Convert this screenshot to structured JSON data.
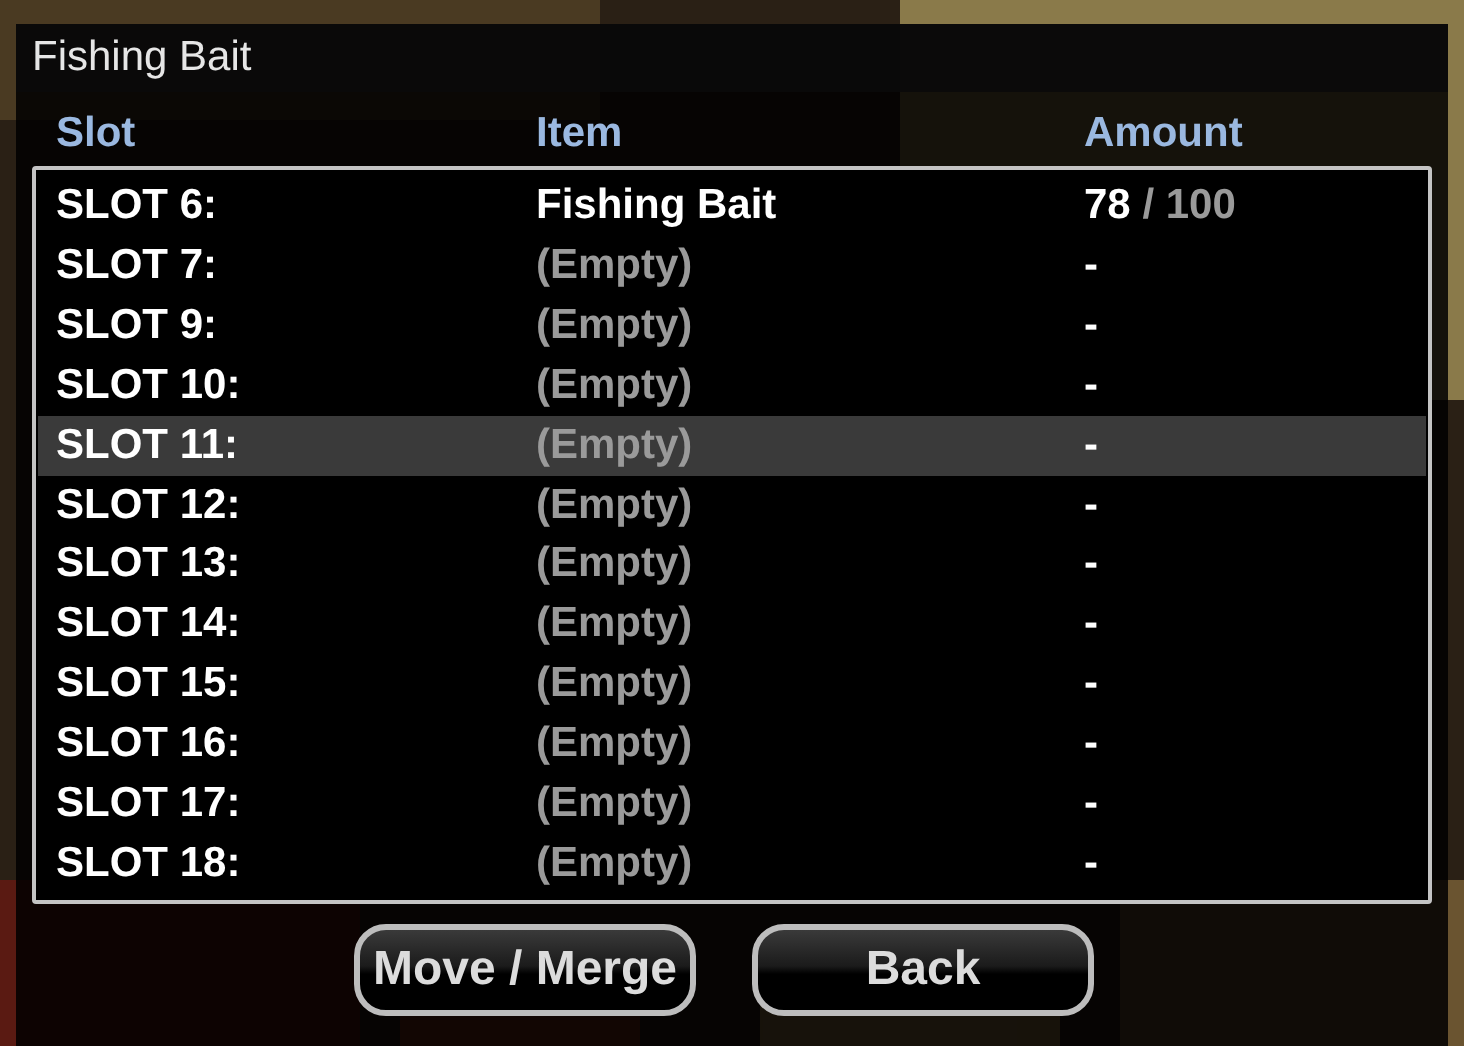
{
  "dialog": {
    "title": "Fishing Bait"
  },
  "columns": [
    "Slot",
    "Item",
    "Amount"
  ],
  "rows": [
    {
      "slot": "SLOT 6:",
      "item": "Fishing Bait",
      "empty": false,
      "amount": "78",
      "capacity": "/ 100",
      "selected": false
    },
    {
      "slot": "SLOT 7:",
      "item": "(Empty)",
      "empty": true,
      "amount": "-",
      "selected": false
    },
    {
      "slot": "SLOT 9:",
      "item": "(Empty)",
      "empty": true,
      "amount": "-",
      "selected": false
    },
    {
      "slot": "SLOT 10:",
      "item": "(Empty)",
      "empty": true,
      "amount": "-",
      "selected": false
    },
    {
      "slot": "SLOT 11:",
      "item": "(Empty)",
      "empty": true,
      "amount": "-",
      "selected": true
    },
    {
      "slot": "SLOT 12:",
      "item": "(Empty)",
      "empty": true,
      "amount": "-",
      "selected": false
    },
    {
      "slot": "SLOT 13:",
      "item": "(Empty)",
      "empty": true,
      "amount": "-",
      "selected": false
    },
    {
      "slot": "SLOT 14:",
      "item": "(Empty)",
      "empty": true,
      "amount": "-",
      "selected": false
    },
    {
      "slot": "SLOT 15:",
      "item": "(Empty)",
      "empty": true,
      "amount": "-",
      "selected": false
    },
    {
      "slot": "SLOT 16:",
      "item": "(Empty)",
      "empty": true,
      "amount": "-",
      "selected": false
    },
    {
      "slot": "SLOT 17:",
      "item": "(Empty)",
      "empty": true,
      "amount": "-",
      "selected": false
    },
    {
      "slot": "SLOT 18:",
      "item": "(Empty)",
      "empty": true,
      "amount": "-",
      "selected": false
    }
  ],
  "buttons": [
    "Move / Merge",
    "Back"
  ]
}
